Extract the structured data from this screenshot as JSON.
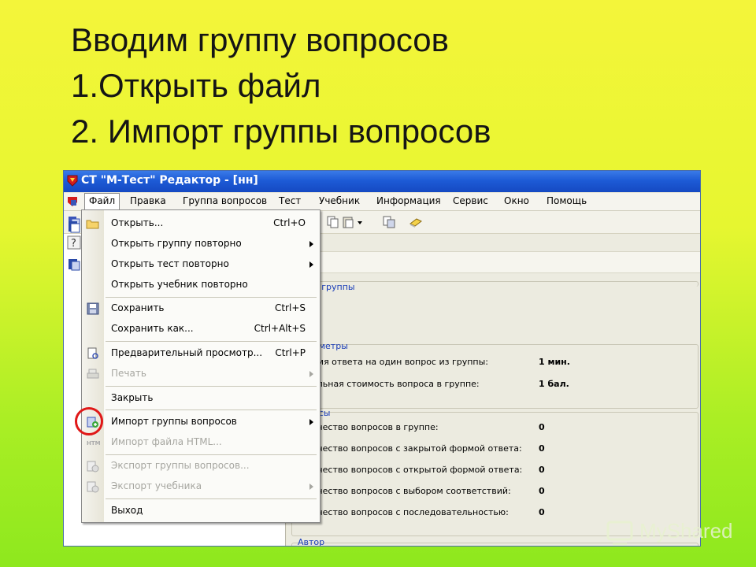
{
  "slide": {
    "title_lines": [
      "Вводим группу вопросов",
      "1.Открыть файл",
      "2. Импорт группы вопросов"
    ]
  },
  "window": {
    "title": "СТ \"М-Тест\" Редактор - [нн]"
  },
  "menubar": {
    "items": [
      "Файл",
      "Правка",
      "Группа вопросов",
      "Тест",
      "Учебник",
      "Информация",
      "Сервис",
      "Окно",
      "Помощь"
    ],
    "active": "Файл"
  },
  "file_menu": {
    "items": [
      {
        "label": "Открыть...",
        "shortcut": "Ctrl+O",
        "icon": "folder-open-icon",
        "enabled": true
      },
      {
        "label": "Открыть группу повторно",
        "submenu": true,
        "enabled": true
      },
      {
        "label": "Открыть тест повторно",
        "submenu": true,
        "enabled": true
      },
      {
        "label": "Открыть учебник повторно",
        "enabled": true
      },
      {
        "label": "Сохранить",
        "shortcut": "Ctrl+S",
        "icon": "save-icon",
        "enabled": true
      },
      {
        "label": "Сохранить как...",
        "shortcut": "Ctrl+Alt+S",
        "enabled": true
      },
      {
        "label": "Предварительный просмотр...",
        "shortcut": "Ctrl+P",
        "icon": "print-preview-icon",
        "enabled": true
      },
      {
        "label": "Печать",
        "submenu": true,
        "icon": "print-icon",
        "enabled": false
      },
      {
        "label": "Закрыть",
        "enabled": true
      },
      {
        "label": "Импорт группы вопросов",
        "submenu": true,
        "icon": "import-group-icon",
        "enabled": true,
        "highlighted": true
      },
      {
        "label": "Импорт файла HTML...",
        "icon": "html-icon",
        "enabled": false
      },
      {
        "label": "Экспорт группы вопросов...",
        "icon": "export-group-icon",
        "enabled": false
      },
      {
        "label": "Экспорт учебника",
        "submenu": true,
        "icon": "export-book-icon",
        "enabled": false
      },
      {
        "label": "Выход",
        "enabled": true
      }
    ]
  },
  "right_panel": {
    "group1_title": "а группы",
    "params_title": "аметры",
    "params": [
      {
        "label": "емя ответа на один вопрос из группы:",
        "value": "1 мин."
      },
      {
        "label": "альная стоимость вопроса в группе:",
        "value": "1 бал."
      }
    ],
    "questions_title": "осы",
    "questions": [
      {
        "label": "ичество вопросов в группе:",
        "value": "0"
      },
      {
        "label": "ичество вопросов с закрытой формой ответа:",
        "value": "0"
      },
      {
        "label": "ичество вопросов с открытой формой ответа:",
        "value": "0"
      },
      {
        "label": "ичество вопросов с выбором соответствий:",
        "value": "0"
      },
      {
        "label": "ичество вопросов с последовательностью:",
        "value": "0"
      }
    ],
    "author_title": "Автор"
  },
  "watermark": {
    "text": "MyShared"
  },
  "colors": {
    "titlebar": "#1d5bd6",
    "highlight_circle": "#e01818",
    "group_title": "#1a3db8"
  }
}
